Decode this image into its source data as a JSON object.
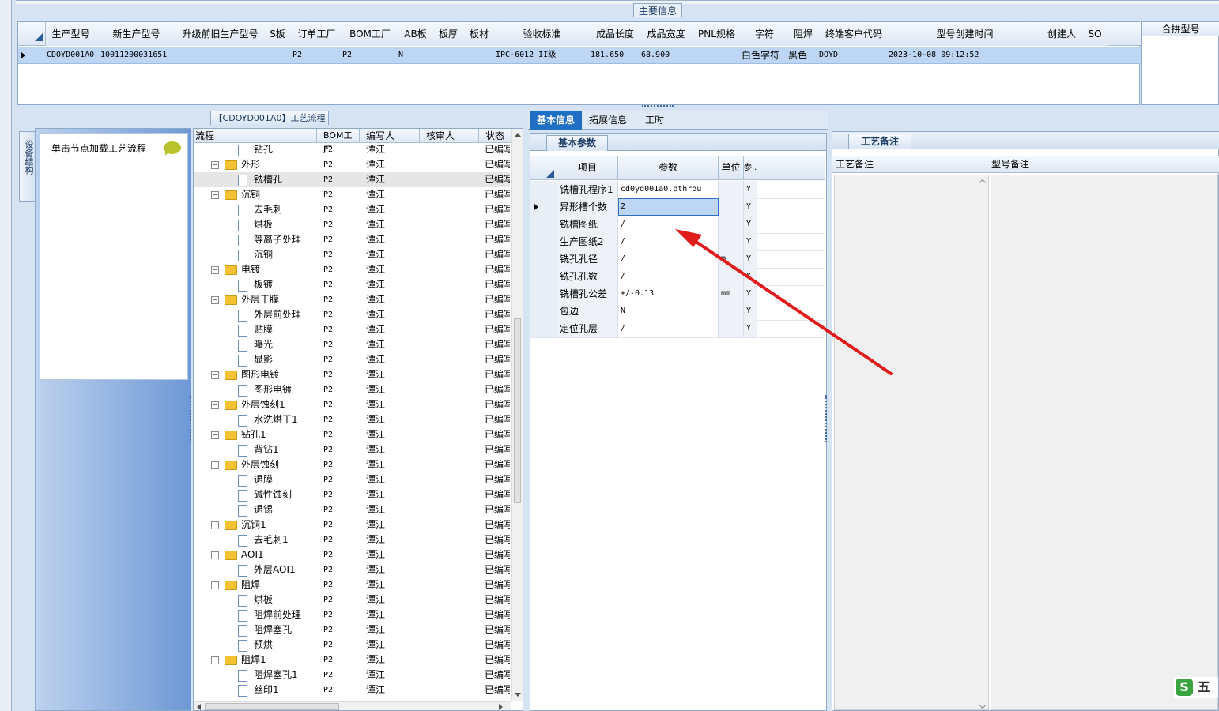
{
  "top_panel": {
    "title": "主要信息",
    "columns": [
      "生产型号",
      "新生产型号",
      "升级前旧生产型号",
      "S板",
      "订单工厂",
      "BOM工厂",
      "AB板",
      "板厚",
      "板材",
      "验收标准",
      "成品长度",
      "成品宽度",
      "PNL规格",
      "字符",
      "阻焊",
      "终端客户代码",
      "型号创建时间",
      "创建人",
      "SO"
    ],
    "row": {
      "生产型号": "CDOYD001A0",
      "新生产型号": "10011200031651",
      "订单工厂": "P2",
      "BOM工厂": "P2",
      "AB板": "N",
      "验收标准": "IPC-6012 II级",
      "成品长度": "181.650",
      "成品宽度": "68.900",
      "字符": "白色字符",
      "阻焊": "黑色",
      "终端客户代码": "DOYD",
      "型号创建时间": "2023-10-08 09:12:52"
    },
    "merge_header": "合拼型号"
  },
  "left_panel": {
    "vertical_tab": "设备结构",
    "hint": "单击节点加载工艺流程"
  },
  "process_panel": {
    "title": "【CDOYD001A0】工艺流程",
    "columns": [
      "流程",
      "BOM工厂",
      "编写人",
      "核审人",
      "状态"
    ],
    "rows": [
      {
        "level": 2,
        "name": "钻孔",
        "bom": "P2",
        "writer": "谭江",
        "status": "已编写"
      },
      {
        "level": 1,
        "name": "外形",
        "bom": "P2",
        "writer": "谭江",
        "status": "已编写"
      },
      {
        "level": 2,
        "name": "铣槽孔",
        "bom": "P2",
        "writer": "谭江",
        "status": "已编写",
        "selected": true
      },
      {
        "level": 1,
        "name": "沉铜",
        "bom": "P2",
        "writer": "谭江",
        "status": "已编写"
      },
      {
        "level": 2,
        "name": "去毛刺",
        "bom": "P2",
        "writer": "谭江",
        "status": "已编写"
      },
      {
        "level": 2,
        "name": "烘板",
        "bom": "P2",
        "writer": "谭江",
        "status": "已编写"
      },
      {
        "level": 2,
        "name": "等离子处理",
        "bom": "P2",
        "writer": "谭江",
        "status": "已编写"
      },
      {
        "level": 2,
        "name": "沉铜",
        "bom": "P2",
        "writer": "谭江",
        "status": "已编写"
      },
      {
        "level": 1,
        "name": "电镀",
        "bom": "P2",
        "writer": "谭江",
        "status": "已编写"
      },
      {
        "level": 2,
        "name": "板镀",
        "bom": "P2",
        "writer": "谭江",
        "status": "已编写"
      },
      {
        "level": 1,
        "name": "外层干膜",
        "bom": "P2",
        "writer": "谭江",
        "status": "已编写"
      },
      {
        "level": 2,
        "name": "外层前处理",
        "bom": "P2",
        "writer": "谭江",
        "status": "已编写"
      },
      {
        "level": 2,
        "name": "贴膜",
        "bom": "P2",
        "writer": "谭江",
        "status": "已编写"
      },
      {
        "level": 2,
        "name": "曝光",
        "bom": "P2",
        "writer": "谭江",
        "status": "已编写"
      },
      {
        "level": 2,
        "name": "显影",
        "bom": "P2",
        "writer": "谭江",
        "status": "已编写"
      },
      {
        "level": 1,
        "name": "图形电镀",
        "bom": "P2",
        "writer": "谭江",
        "status": "已编写"
      },
      {
        "level": 2,
        "name": "图形电镀",
        "bom": "P2",
        "writer": "谭江",
        "status": "已编写"
      },
      {
        "level": 1,
        "name": "外层蚀刻1",
        "bom": "P2",
        "writer": "谭江",
        "status": "已编写"
      },
      {
        "level": 2,
        "name": "水洗烘干1",
        "bom": "P2",
        "writer": "谭江",
        "status": "已编写"
      },
      {
        "level": 1,
        "name": "钻孔1",
        "bom": "P2",
        "writer": "谭江",
        "status": "已编写"
      },
      {
        "level": 2,
        "name": "背钻1",
        "bom": "P2",
        "writer": "谭江",
        "status": "已编写"
      },
      {
        "level": 1,
        "name": "外层蚀刻",
        "bom": "P2",
        "writer": "谭江",
        "status": "已编写"
      },
      {
        "level": 2,
        "name": "退膜",
        "bom": "P2",
        "writer": "谭江",
        "status": "已编写"
      },
      {
        "level": 2,
        "name": "碱性蚀刻",
        "bom": "P2",
        "writer": "谭江",
        "status": "已编写"
      },
      {
        "level": 2,
        "name": "退锡",
        "bom": "P2",
        "writer": "谭江",
        "status": "已编写"
      },
      {
        "level": 1,
        "name": "沉铜1",
        "bom": "P2",
        "writer": "谭江",
        "status": "已编写"
      },
      {
        "level": 2,
        "name": "去毛刺1",
        "bom": "P2",
        "writer": "谭江",
        "status": "已编写"
      },
      {
        "level": 1,
        "name": "AOI1",
        "bom": "P2",
        "writer": "谭江",
        "status": "已编写"
      },
      {
        "level": 2,
        "name": "外层AOI1",
        "bom": "P2",
        "writer": "谭江",
        "status": "已编写"
      },
      {
        "level": 1,
        "name": "阻焊",
        "bom": "P2",
        "writer": "谭江",
        "status": "已编写"
      },
      {
        "level": 2,
        "name": "烘板",
        "bom": "P2",
        "writer": "谭江",
        "status": "已编写"
      },
      {
        "level": 2,
        "name": "阻焊前处理",
        "bom": "P2",
        "writer": "谭江",
        "status": "已编写"
      },
      {
        "level": 2,
        "name": "阻焊塞孔",
        "bom": "P2",
        "writer": "谭江",
        "status": "已编写"
      },
      {
        "level": 2,
        "name": "预烘",
        "bom": "P2",
        "writer": "谭江",
        "status": "已编写"
      },
      {
        "level": 1,
        "name": "阻焊1",
        "bom": "P2",
        "writer": "谭江",
        "status": "已编写"
      },
      {
        "level": 2,
        "name": "阻焊塞孔1",
        "bom": "P2",
        "writer": "谭江",
        "status": "已编写"
      },
      {
        "level": 2,
        "name": "丝印1",
        "bom": "P2",
        "writer": "谭江",
        "status": "已编写"
      }
    ]
  },
  "detail_tabs": [
    "基本信息",
    "拓展信息",
    "工时"
  ],
  "basic_params": {
    "title": "基本参数",
    "columns": [
      "项目",
      "参数",
      "单位",
      "参.."
    ],
    "rows": [
      {
        "item": "铣槽孔程序1",
        "value": "cd0yd001a0.pthrou",
        "unit": "",
        "flag": "Y"
      },
      {
        "item": "异形槽个数",
        "value": "2",
        "unit": "",
        "flag": "Y",
        "selected": true
      },
      {
        "item": "铣槽图纸",
        "value": "/",
        "unit": "",
        "flag": "Y"
      },
      {
        "item": "生产图纸2",
        "value": "/",
        "unit": "",
        "flag": "Y"
      },
      {
        "item": "铣孔孔径",
        "value": "/",
        "unit": "m",
        "flag": "Y"
      },
      {
        "item": "铣孔孔数",
        "value": "/",
        "unit": "",
        "flag": "Y"
      },
      {
        "item": "铣槽孔公差",
        "value": "+/-0.13",
        "unit": "mm",
        "flag": "Y"
      },
      {
        "item": "包边",
        "value": "N",
        "unit": "",
        "flag": "Y"
      },
      {
        "item": "定位孔层",
        "value": "/",
        "unit": "",
        "flag": "Y"
      }
    ]
  },
  "notes_panel": {
    "title": "工艺备注",
    "columns": [
      "工艺备注",
      "型号备注"
    ]
  },
  "ime": {
    "label": "五"
  },
  "colors": {
    "accent": "#1f6fc4",
    "selected_row": "#bcd6f3",
    "arrow": "#e01b1b"
  }
}
